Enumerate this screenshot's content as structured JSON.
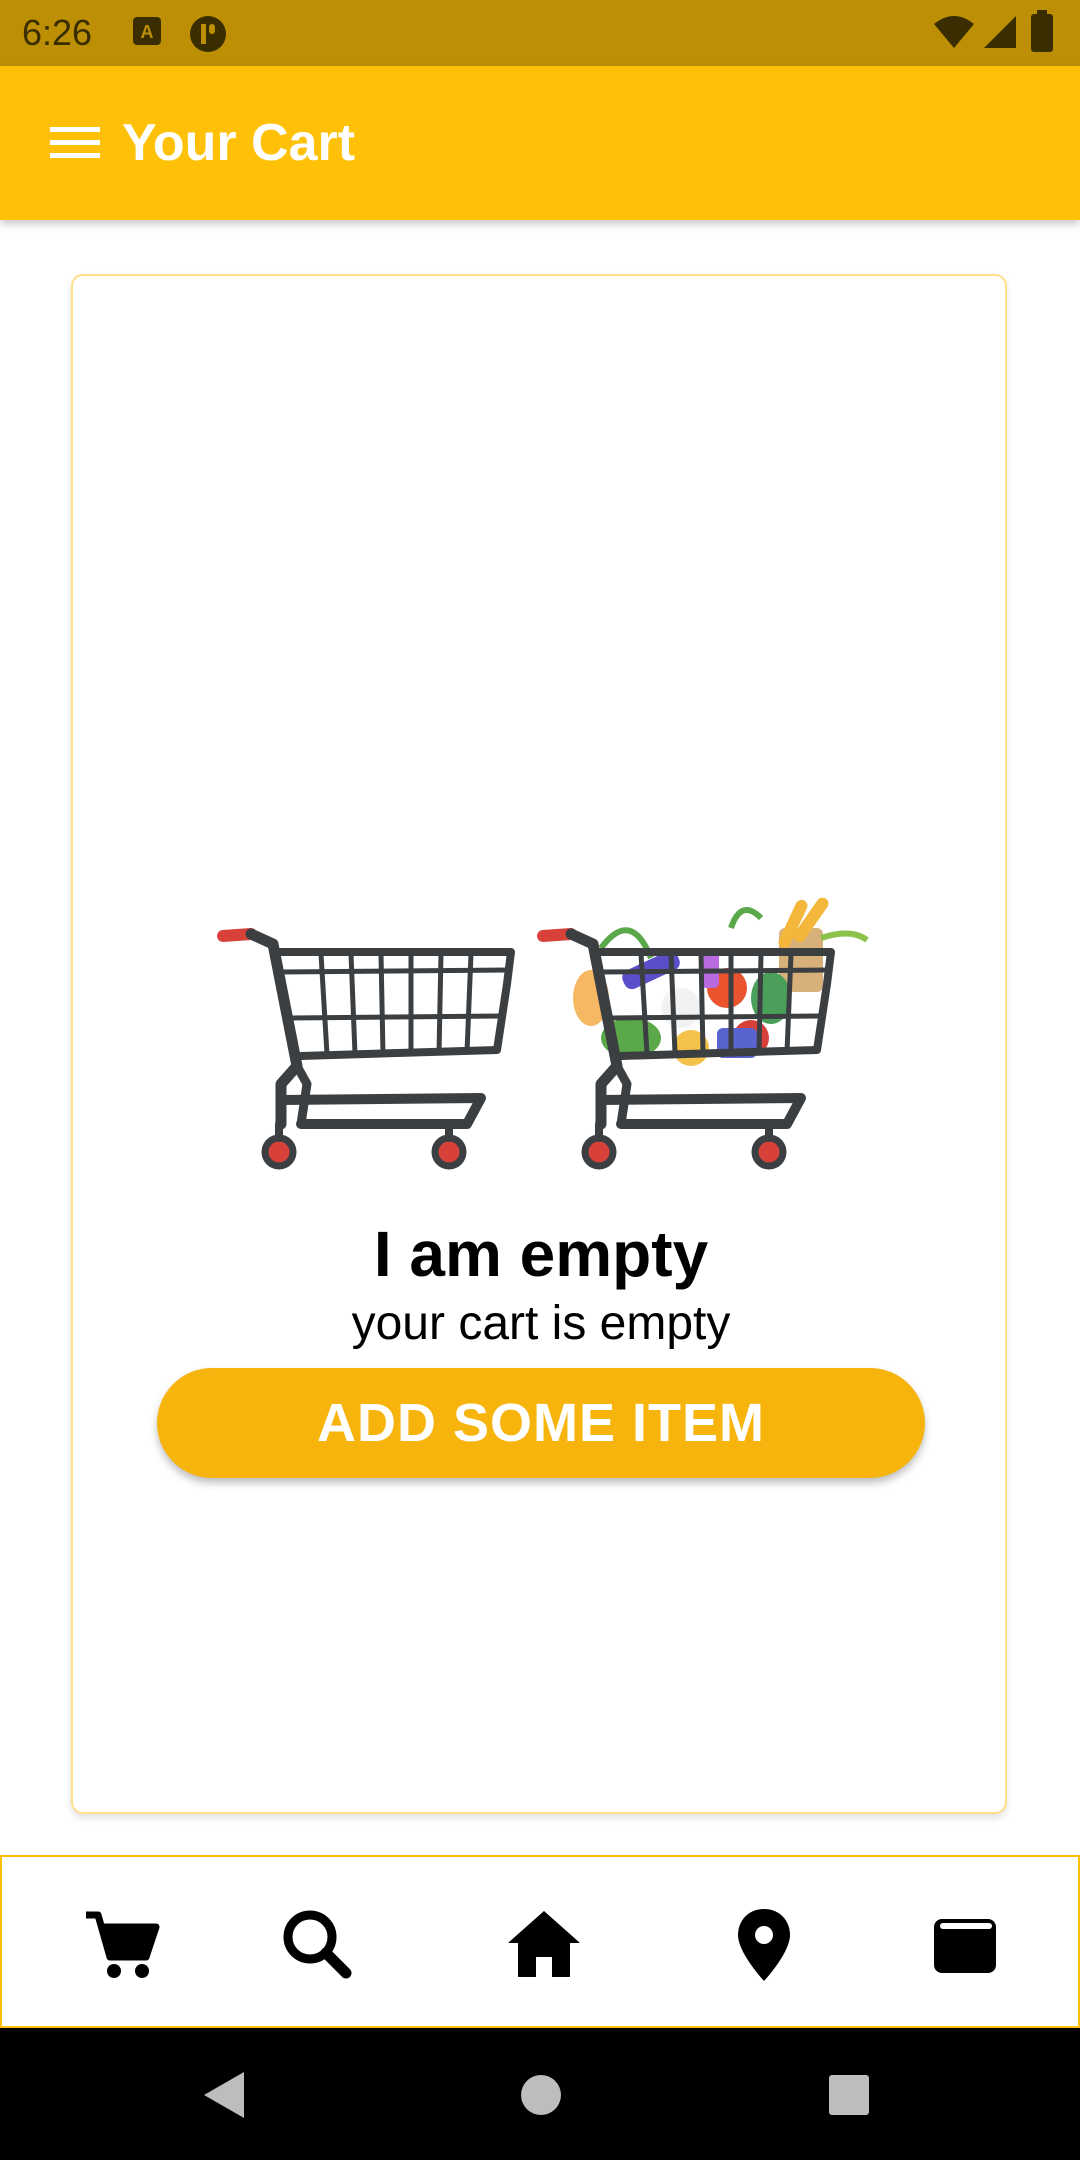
{
  "status_bar": {
    "time": "6:26",
    "left_icons": [
      "a-badge-icon",
      "app-circle-icon"
    ],
    "right_icons": [
      "wifi-icon",
      "signal-icon",
      "battery-icon"
    ],
    "background": "#BC8F05"
  },
  "app_bar": {
    "title": "Your Cart",
    "menu_icon": "hamburger-menu-icon",
    "background": "#FFC107"
  },
  "empty_state": {
    "title": "I am empty",
    "subtitle": "your cart is empty",
    "button_label": "ADD SOME ITEM",
    "button_color": "#F6B40C",
    "illustration": "empty-and-full-shopping-carts"
  },
  "bottom_nav": {
    "items": [
      {
        "icon": "cart-icon"
      },
      {
        "icon": "search-icon"
      },
      {
        "icon": "home-icon"
      },
      {
        "icon": "location-pin-icon"
      },
      {
        "icon": "wallet-icon"
      }
    ],
    "border_color": "#FFC107"
  },
  "system_nav": {
    "buttons": [
      "back-icon",
      "home-circle-icon",
      "recents-square-icon"
    ]
  }
}
